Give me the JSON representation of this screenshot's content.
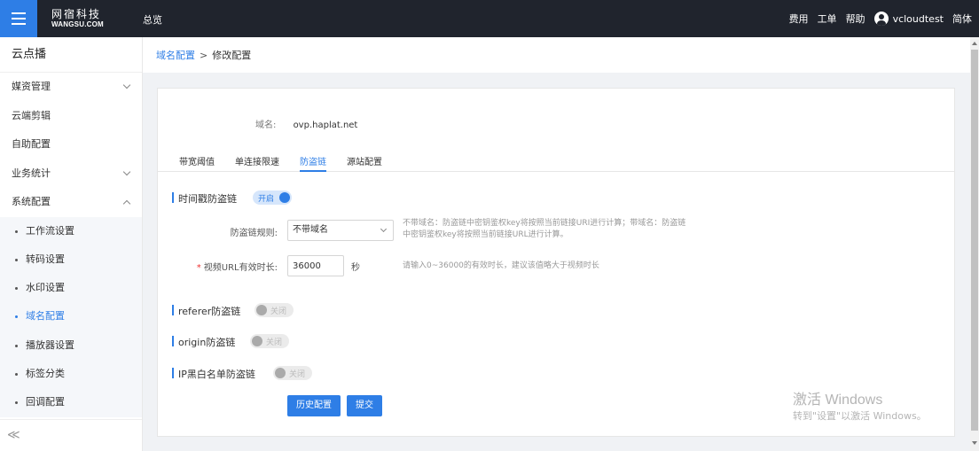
{
  "topbar": {
    "logo_cn": "网宿科技",
    "logo_en": "WANGSU.COM",
    "nav_overview": "总览",
    "links": [
      "费用",
      "工单",
      "帮助"
    ],
    "username": "vcloudtest",
    "language": "简体",
    "accent": "#2e7ee6",
    "background": "#20242d"
  },
  "sidebar": {
    "title": "云点播",
    "items": [
      {
        "label": "媒资管理",
        "expandable": "collapsed"
      },
      {
        "label": "云端剪辑"
      },
      {
        "label": "自助配置"
      },
      {
        "label": "业务统计",
        "expandable": "collapsed"
      },
      {
        "label": "系统配置",
        "expandable": "expanded"
      }
    ],
    "sub_items": [
      {
        "label": "工作流设置"
      },
      {
        "label": "转码设置"
      },
      {
        "label": "水印设置"
      },
      {
        "label": "域名配置",
        "active": true
      },
      {
        "label": "播放器设置"
      },
      {
        "label": "标签分类"
      },
      {
        "label": "回调配置"
      }
    ],
    "collapse_glyph": "≪"
  },
  "breadcrumb": {
    "link": "域名配置",
    "separator": ">",
    "current": "修改配置"
  },
  "form": {
    "domain_label": "域名:",
    "domain_value": "ovp.haplat.net",
    "tabs": [
      "带宽阈值",
      "单连接限速",
      "防盗链",
      "源站配置"
    ],
    "active_tab": "防盗链",
    "timestamp": {
      "title": "时间戳防盗链",
      "toggle": "开启",
      "rule_label": "防盗链规则:",
      "rule_value": "不带域名",
      "rule_hint_1": "不带域名：防盗链中密钥鉴权key将按照当前链接URI进行计算；带域名：防盗链",
      "rule_hint_2": "中密钥鉴权key将按照当前链接URL进行计算。",
      "validity_required": "*",
      "validity_label": "视频URL有效时长:",
      "validity_value": "36000",
      "validity_unit": "秒",
      "validity_hint": "请输入0~36000的有效时长，建议该值略大于视频时长"
    },
    "referer": {
      "title": "referer防盗链",
      "toggle": "关闭"
    },
    "origin": {
      "title": "origin防盗链",
      "toggle": "关闭"
    },
    "ip": {
      "title": "IP黑白名单防盗链",
      "toggle": "关闭"
    },
    "history_button": "历史配置",
    "submit_button": "提交"
  },
  "watermark": {
    "line1": "激活 Windows",
    "line2": "转到\"设置\"以激活 Windows。"
  }
}
